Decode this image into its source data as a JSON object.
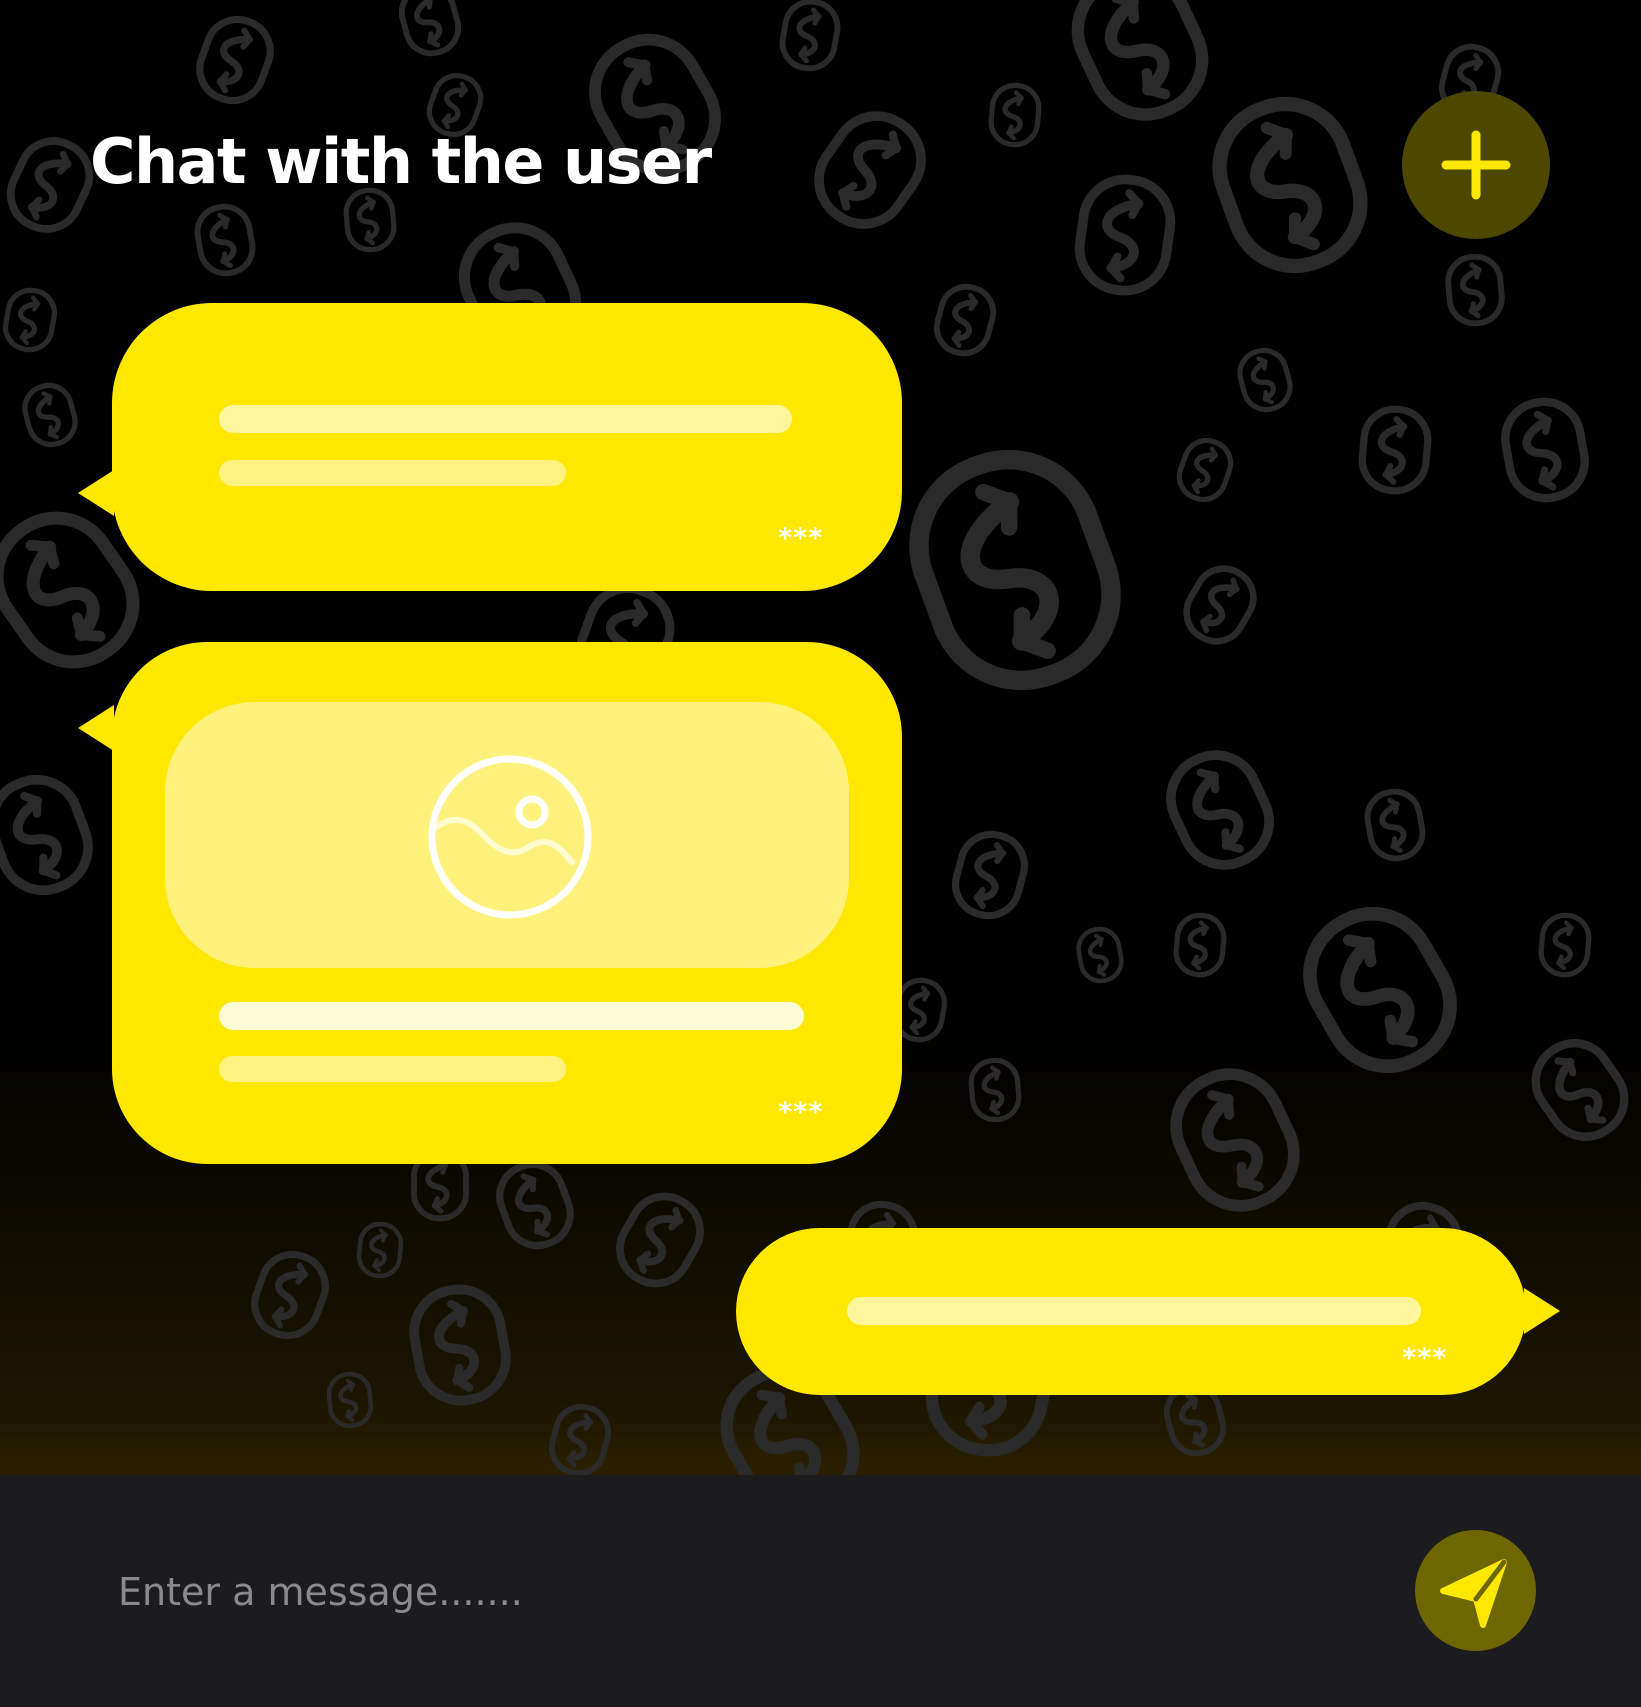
{
  "header": {
    "title": "Chat with the user",
    "add_icon": "plus-icon"
  },
  "messages": [
    {
      "direction": "incoming",
      "kind": "text",
      "meta": "***"
    },
    {
      "direction": "incoming",
      "kind": "image",
      "media_icon": "image-icon",
      "meta": "***"
    },
    {
      "direction": "outgoing",
      "kind": "text",
      "meta": "***"
    }
  ],
  "composer": {
    "placeholder": "Enter a message.......",
    "value": "",
    "send_icon": "send-icon"
  },
  "colors": {
    "accent": "#ffe800",
    "text_placeholder_line": "#fff59a",
    "background": "#000000",
    "composer": "#1c1c1e",
    "button_dark_accent": "#4d4800"
  }
}
